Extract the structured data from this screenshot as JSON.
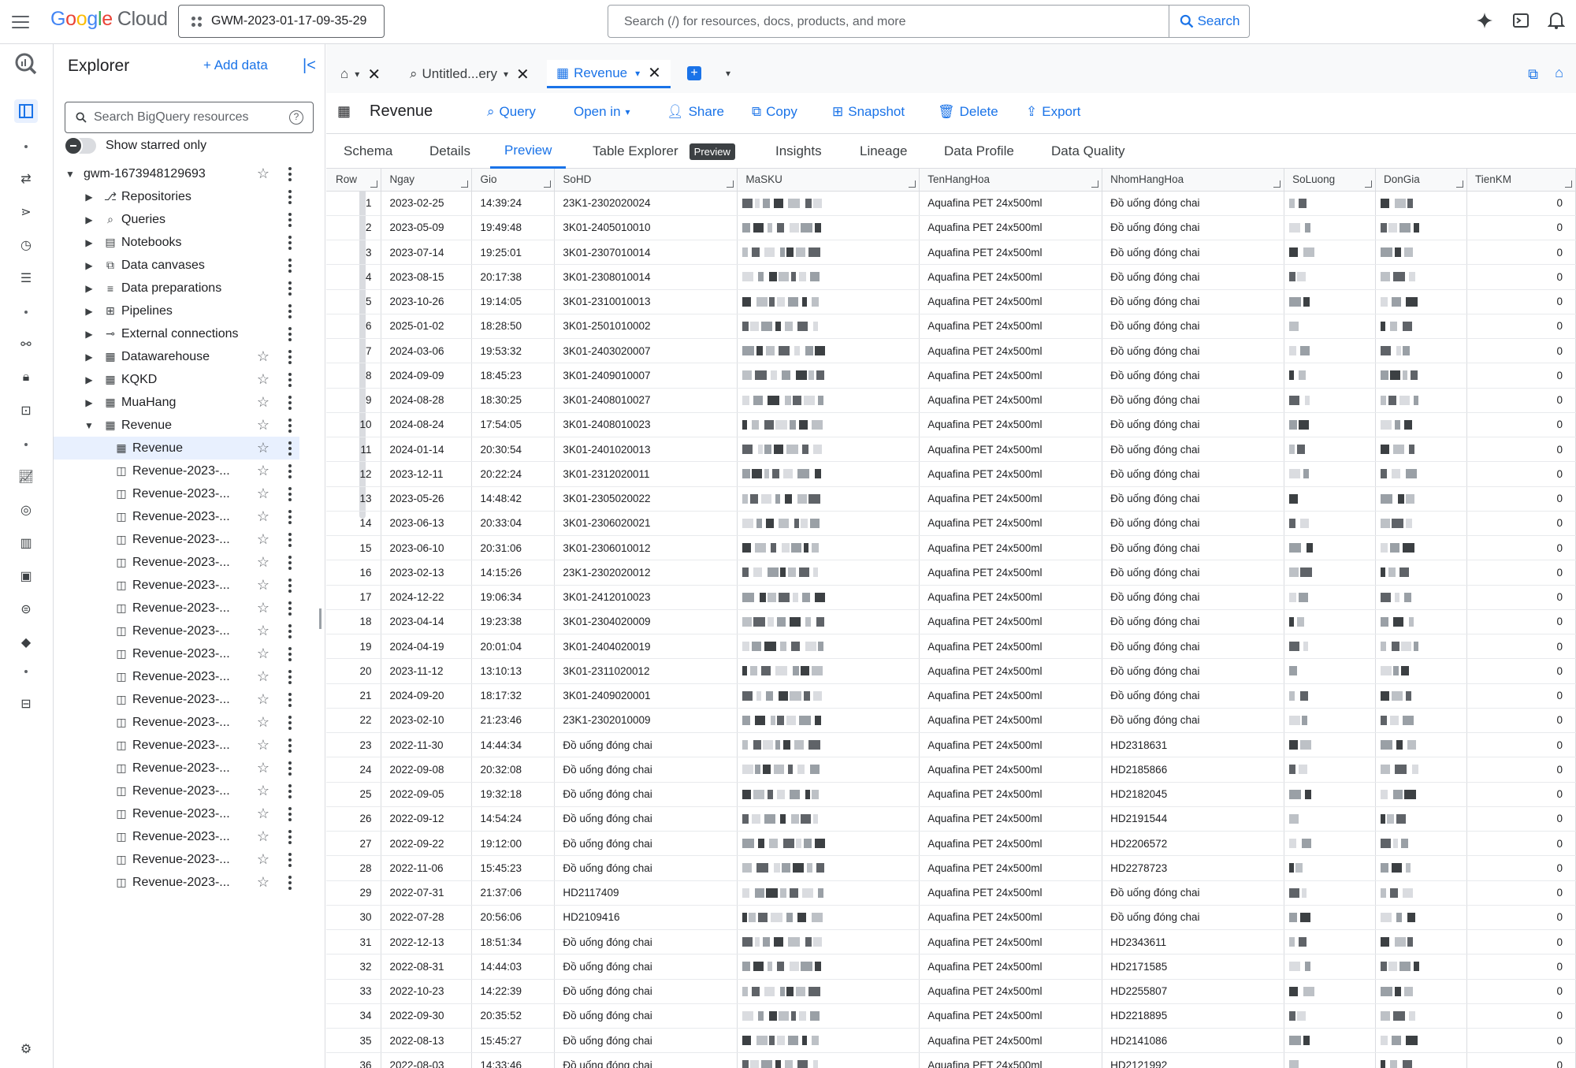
{
  "topbar": {
    "logo_google": [
      "G",
      "o",
      "o",
      "g",
      "l",
      "e"
    ],
    "logo_cloud": "Cloud",
    "project": "GWM-2023-01-17-09-35-29",
    "search_placeholder": "Search (/) for resources, docs, products, and more",
    "search_button": "Search"
  },
  "explorer": {
    "title": "Explorer",
    "add_data": "+ Add data",
    "search_placeholder": "Search BigQuery resources",
    "show_starred": "Show starred only",
    "items": [
      {
        "label": "gwm-1673948129693",
        "level": 0,
        "caret": "down",
        "glyph": "",
        "star": true
      },
      {
        "label": "Repositories",
        "level": 1,
        "caret": "right",
        "glyph": "⎇",
        "star": false
      },
      {
        "label": "Queries",
        "level": 1,
        "caret": "right",
        "glyph": "⌕",
        "star": false
      },
      {
        "label": "Notebooks",
        "level": 1,
        "caret": "right",
        "glyph": "▤",
        "star": false
      },
      {
        "label": "Data canvases",
        "level": 1,
        "caret": "right",
        "glyph": "⧉",
        "star": false
      },
      {
        "label": "Data preparations",
        "level": 1,
        "caret": "right",
        "glyph": "≡",
        "star": false
      },
      {
        "label": "Pipelines",
        "level": 1,
        "caret": "right",
        "glyph": "⊞",
        "star": false
      },
      {
        "label": "External connections",
        "level": 1,
        "caret": "right",
        "glyph": "⊸",
        "star": false
      },
      {
        "label": "Datawarehouse",
        "level": 1,
        "caret": "right",
        "glyph": "▦",
        "star": true
      },
      {
        "label": "KQKD",
        "level": 1,
        "caret": "right",
        "glyph": "▦",
        "star": true
      },
      {
        "label": "MuaHang",
        "level": 1,
        "caret": "right",
        "glyph": "▦",
        "star": true
      },
      {
        "label": "Revenue",
        "level": 1,
        "caret": "down",
        "glyph": "▦",
        "star": true
      },
      {
        "label": "Revenue",
        "level": 2,
        "caret": "",
        "glyph": "▦",
        "star": true,
        "selected": true
      },
      {
        "label": "Revenue-2023-...",
        "level": 2,
        "caret": "",
        "glyph": "◫",
        "star": true
      },
      {
        "label": "Revenue-2023-...",
        "level": 2,
        "caret": "",
        "glyph": "◫",
        "star": true
      },
      {
        "label": "Revenue-2023-...",
        "level": 2,
        "caret": "",
        "glyph": "◫",
        "star": true
      },
      {
        "label": "Revenue-2023-...",
        "level": 2,
        "caret": "",
        "glyph": "◫",
        "star": true
      },
      {
        "label": "Revenue-2023-...",
        "level": 2,
        "caret": "",
        "glyph": "◫",
        "star": true
      },
      {
        "label": "Revenue-2023-...",
        "level": 2,
        "caret": "",
        "glyph": "◫",
        "star": true
      },
      {
        "label": "Revenue-2023-...",
        "level": 2,
        "caret": "",
        "glyph": "◫",
        "star": true
      },
      {
        "label": "Revenue-2023-...",
        "level": 2,
        "caret": "",
        "glyph": "◫",
        "star": true
      },
      {
        "label": "Revenue-2023-...",
        "level": 2,
        "caret": "",
        "glyph": "◫",
        "star": true
      },
      {
        "label": "Revenue-2023-...",
        "level": 2,
        "caret": "",
        "glyph": "◫",
        "star": true
      },
      {
        "label": "Revenue-2023-...",
        "level": 2,
        "caret": "",
        "glyph": "◫",
        "star": true
      },
      {
        "label": "Revenue-2023-...",
        "level": 2,
        "caret": "",
        "glyph": "◫",
        "star": true
      },
      {
        "label": "Revenue-2023-...",
        "level": 2,
        "caret": "",
        "glyph": "◫",
        "star": true
      },
      {
        "label": "Revenue-2023-...",
        "level": 2,
        "caret": "",
        "glyph": "◫",
        "star": true
      },
      {
        "label": "Revenue-2023-...",
        "level": 2,
        "caret": "",
        "glyph": "◫",
        "star": true
      },
      {
        "label": "Revenue-2023-...",
        "level": 2,
        "caret": "",
        "glyph": "◫",
        "star": true
      },
      {
        "label": "Revenue-2023-...",
        "level": 2,
        "caret": "",
        "glyph": "◫",
        "star": true
      },
      {
        "label": "Revenue-2023-...",
        "level": 2,
        "caret": "",
        "glyph": "◫",
        "star": true
      },
      {
        "label": "Revenue-2023-...",
        "level": 2,
        "caret": "",
        "glyph": "◫",
        "star": true
      }
    ]
  },
  "tabs": [
    {
      "label": "",
      "icon": "home-icon"
    },
    {
      "label": "Untitled...ery",
      "icon": "query-icon"
    },
    {
      "label": "Revenue",
      "icon": "table-icon",
      "active": true
    }
  ],
  "toolbar": {
    "title": "Revenue",
    "buttons": [
      "Query",
      "Open in",
      "Share",
      "Copy",
      "Snapshot",
      "Delete",
      "Export"
    ]
  },
  "subtabs": [
    "Schema",
    "Details",
    "Preview",
    "Table Explorer",
    "Insights",
    "Lineage",
    "Data Profile",
    "Data Quality"
  ],
  "subtab_badge": "Preview",
  "active_subtab": "Preview",
  "columns": [
    "Row",
    "Ngay",
    "Gio",
    "SoHD",
    "MaSKU",
    "TenHangHoa",
    "NhomHangHoa",
    "SoLuong",
    "DonGia",
    "TienKM"
  ],
  "rows": [
    [
      "1",
      "2023-02-25",
      "14:39:24",
      "23K1-2302020024",
      "Aquafina PET 24x500ml",
      "Đồ uống đóng chai",
      "0"
    ],
    [
      "2",
      "2023-05-09",
      "19:49:48",
      "3K01-2405010010",
      "Aquafina PET 24x500ml",
      "Đồ uống đóng chai",
      "0"
    ],
    [
      "3",
      "2023-07-14",
      "19:25:01",
      "3K01-2307010014",
      "Aquafina PET 24x500ml",
      "Đồ uống đóng chai",
      "0"
    ],
    [
      "4",
      "2023-08-15",
      "20:17:38",
      "3K01-2308010014",
      "Aquafina PET 24x500ml",
      "Đồ uống đóng chai",
      "0"
    ],
    [
      "5",
      "2023-10-26",
      "19:14:05",
      "3K01-2310010013",
      "Aquafina PET 24x500ml",
      "Đồ uống đóng chai",
      "0"
    ],
    [
      "6",
      "2025-01-02",
      "18:28:50",
      "3K01-2501010002",
      "Aquafina PET 24x500ml",
      "Đồ uống đóng chai",
      "0"
    ],
    [
      "7",
      "2024-03-06",
      "19:53:32",
      "3K01-2403020007",
      "Aquafina PET 24x500ml",
      "Đồ uống đóng chai",
      "0"
    ],
    [
      "8",
      "2024-09-09",
      "18:45:23",
      "3K01-2409010007",
      "Aquafina PET 24x500ml",
      "Đồ uống đóng chai",
      "0"
    ],
    [
      "9",
      "2024-08-28",
      "18:30:25",
      "3K01-2408010027",
      "Aquafina PET 24x500ml",
      "Đồ uống đóng chai",
      "0"
    ],
    [
      "10",
      "2024-08-24",
      "17:54:05",
      "3K01-2408010023",
      "Aquafina PET 24x500ml",
      "Đồ uống đóng chai",
      "0"
    ],
    [
      "11",
      "2024-01-14",
      "20:30:54",
      "3K01-2401020013",
      "Aquafina PET 24x500ml",
      "Đồ uống đóng chai",
      "0"
    ],
    [
      "12",
      "2023-12-11",
      "20:22:24",
      "3K01-2312020011",
      "Aquafina PET 24x500ml",
      "Đồ uống đóng chai",
      "0"
    ],
    [
      "13",
      "2023-05-26",
      "14:48:42",
      "3K01-2305020022",
      "Aquafina PET 24x500ml",
      "Đồ uống đóng chai",
      "0"
    ],
    [
      "14",
      "2023-06-13",
      "20:33:04",
      "3K01-2306020021",
      "Aquafina PET 24x500ml",
      "Đồ uống đóng chai",
      "0"
    ],
    [
      "15",
      "2023-06-10",
      "20:31:06",
      "3K01-2306010012",
      "Aquafina PET 24x500ml",
      "Đồ uống đóng chai",
      "0"
    ],
    [
      "16",
      "2023-02-13",
      "14:15:26",
      "23K1-2302020012",
      "Aquafina PET 24x500ml",
      "Đồ uống đóng chai",
      "0"
    ],
    [
      "17",
      "2024-12-22",
      "19:06:34",
      "3K01-2412010023",
      "Aquafina PET 24x500ml",
      "Đồ uống đóng chai",
      "0"
    ],
    [
      "18",
      "2023-04-14",
      "19:23:38",
      "3K01-2304020009",
      "Aquafina PET 24x500ml",
      "Đồ uống đóng chai",
      "0"
    ],
    [
      "19",
      "2024-04-19",
      "20:01:04",
      "3K01-2404020019",
      "Aquafina PET 24x500ml",
      "Đồ uống đóng chai",
      "0"
    ],
    [
      "20",
      "2023-11-12",
      "13:10:13",
      "3K01-2311020012",
      "Aquafina PET 24x500ml",
      "Đồ uống đóng chai",
      "0"
    ],
    [
      "21",
      "2024-09-20",
      "18:17:32",
      "3K01-2409020001",
      "Aquafina PET 24x500ml",
      "Đồ uống đóng chai",
      "0"
    ],
    [
      "22",
      "2023-02-10",
      "21:23:46",
      "23K1-2302010009",
      "Aquafina PET 24x500ml",
      "Đồ uống đóng chai",
      "0"
    ],
    [
      "23",
      "2022-11-30",
      "14:44:34",
      "Đồ uống đóng chai",
      "Aquafina PET 24x500ml",
      "HD2318631",
      "0"
    ],
    [
      "24",
      "2022-09-08",
      "20:32:08",
      "Đồ uống đóng chai",
      "Aquafina PET 24x500ml",
      "HD2185866",
      "0"
    ],
    [
      "25",
      "2022-09-05",
      "19:32:18",
      "Đồ uống đóng chai",
      "Aquafina PET 24x500ml",
      "HD2182045",
      "0"
    ],
    [
      "26",
      "2022-09-12",
      "14:54:24",
      "Đồ uống đóng chai",
      "Aquafina PET 24x500ml",
      "HD2191544",
      "0"
    ],
    [
      "27",
      "2022-09-22",
      "19:12:00",
      "Đồ uống đóng chai",
      "Aquafina PET 24x500ml",
      "HD2206572",
      "0"
    ],
    [
      "28",
      "2022-11-06",
      "15:45:23",
      "Đồ uống đóng chai",
      "Aquafina PET 24x500ml",
      "HD2278723",
      "0"
    ],
    [
      "29",
      "2022-07-31",
      "21:37:06",
      "HD2117409",
      "Aquafina PET 24x500ml",
      "Đồ uống đóng chai",
      "0"
    ],
    [
      "30",
      "2022-07-28",
      "20:56:06",
      "HD2109416",
      "Aquafina PET 24x500ml",
      "Đồ uống đóng chai",
      "0"
    ],
    [
      "31",
      "2022-12-13",
      "18:51:34",
      "Đồ uống đóng chai",
      "Aquafina PET 24x500ml",
      "HD2343611",
      "0"
    ],
    [
      "32",
      "2022-08-31",
      "14:44:03",
      "Đồ uống đóng chai",
      "Aquafina PET 24x500ml",
      "HD2171585",
      "0"
    ],
    [
      "33",
      "2022-10-23",
      "14:22:39",
      "Đồ uống đóng chai",
      "Aquafina PET 24x500ml",
      "HD2255807",
      "0"
    ],
    [
      "34",
      "2022-09-30",
      "20:35:52",
      "Đồ uống đóng chai",
      "Aquafina PET 24x500ml",
      "HD2218895",
      "0"
    ],
    [
      "35",
      "2022-08-13",
      "15:45:27",
      "Đồ uống đóng chai",
      "Aquafina PET 24x500ml",
      "HD2141086",
      "0"
    ],
    [
      "36",
      "2022-08-03",
      "14:33:46",
      "Đồ uống đóng chai",
      "Aquafina PET 24x500ml",
      "HD2121992",
      "0"
    ]
  ],
  "colors": {
    "accent": "#1a73e8",
    "border": "#dadce0",
    "selected": "#e8f0fe"
  }
}
